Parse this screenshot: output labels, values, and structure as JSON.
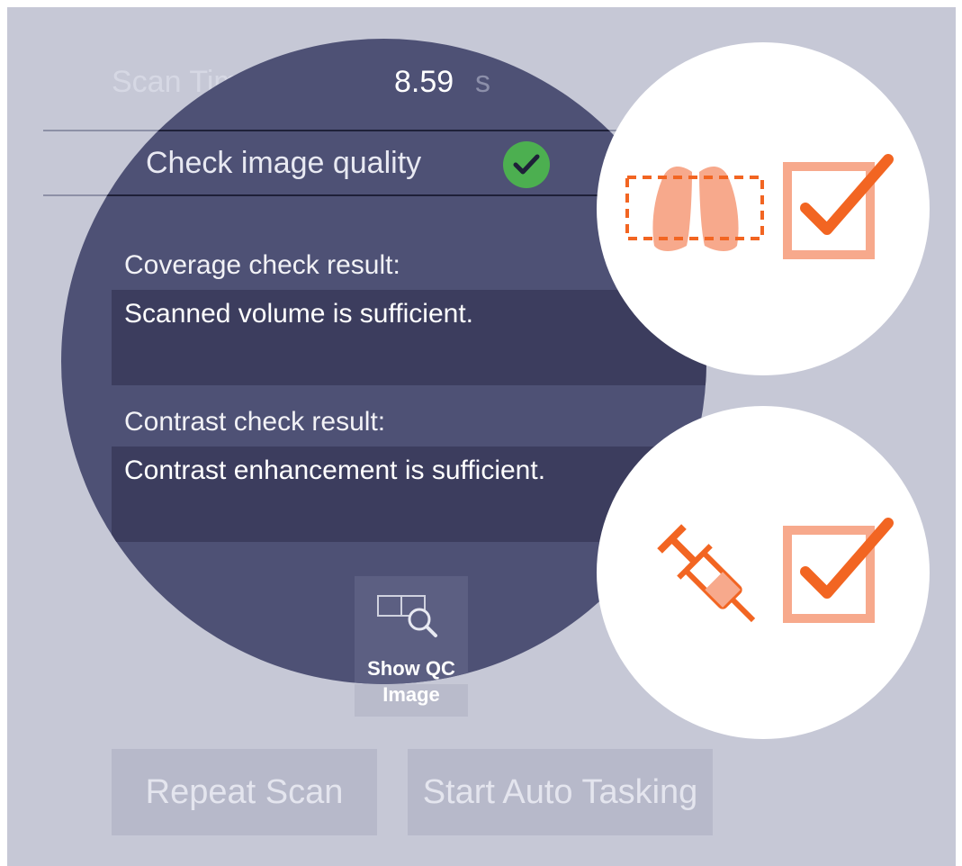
{
  "scan": {
    "label": "Scan Time",
    "value": "8.59",
    "unit": "s"
  },
  "check": {
    "label": "Check image quality",
    "status_icon": "check-circle-icon",
    "status_color": "#4caf50"
  },
  "coverage": {
    "label": "Coverage check result:",
    "text": "Scanned volume is sufficient."
  },
  "contrast": {
    "label": "Contrast check result:",
    "text": "Contrast enhancement is sufficient."
  },
  "qc": {
    "line1": "Show QC",
    "line2": "Image",
    "icon": "qc-image-magnifier-icon"
  },
  "buttons": {
    "repeat": "Repeat Scan",
    "auto": "Start Auto Tasking"
  },
  "callouts": [
    {
      "icon": "lungs-coverage-icon",
      "status_icon": "checkbox-checked-icon"
    },
    {
      "icon": "syringe-icon",
      "status_icon": "checkbox-checked-icon"
    }
  ],
  "colors": {
    "accent": "#f26522",
    "panel": "#c6c8d6",
    "lens": "#4e5175",
    "result_box": "#3c3d5e"
  }
}
